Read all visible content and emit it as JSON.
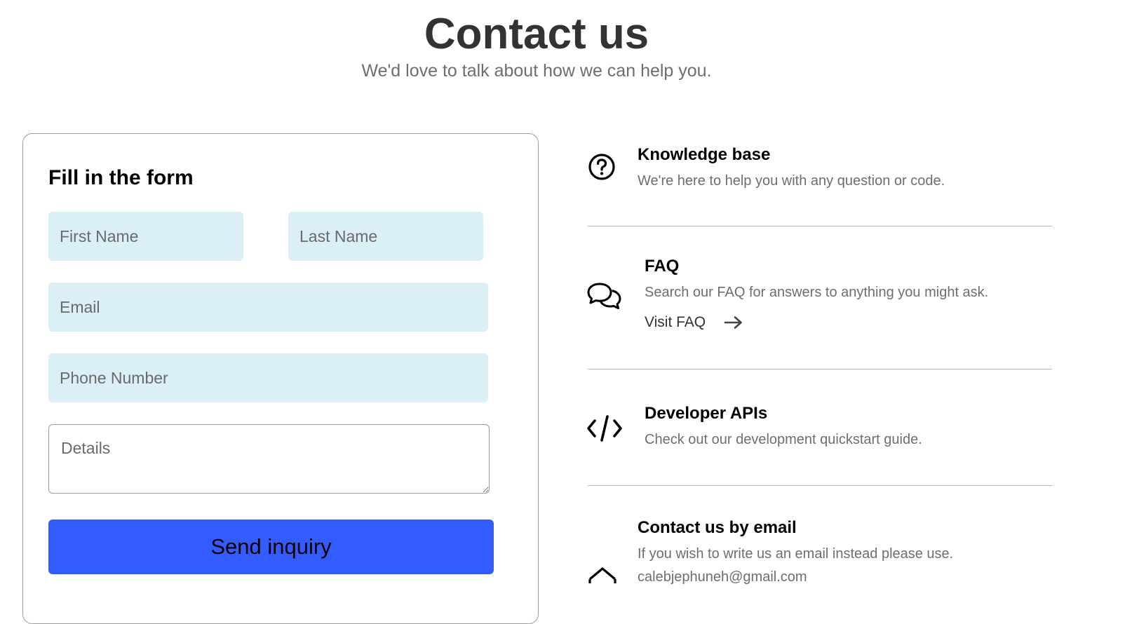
{
  "header": {
    "title": "Contact us",
    "subtitle": "We'd love to talk about how we can help you."
  },
  "form": {
    "heading": "Fill in the form",
    "first_name_placeholder": "First Name",
    "last_name_placeholder": "Last Name",
    "email_placeholder": "Email",
    "phone_placeholder": "Phone Number",
    "details_placeholder": "Details",
    "submit_label": "Send inquiry",
    "field_bg_color": "#dbeff7",
    "button_color": "#335cff"
  },
  "info": {
    "knowledge": {
      "icon": "question-circle-icon",
      "title": "Knowledge base",
      "desc": "We're here to help you with any question or code."
    },
    "faq": {
      "icon": "chat-bubbles-icon",
      "title": "FAQ",
      "desc": "Search our FAQ for answers to anything you might ask.",
      "link_label": "Visit FAQ",
      "link_icon": "arrow-right-icon"
    },
    "developer": {
      "icon": "code-icon",
      "title": "Developer APIs",
      "desc": "Check out our development quickstart guide."
    },
    "email": {
      "icon": "envelope-icon",
      "title": "Contact us by email",
      "desc": "If you wish to write us an email instead please use.",
      "address": "calebjephuneh@gmail.com"
    }
  }
}
